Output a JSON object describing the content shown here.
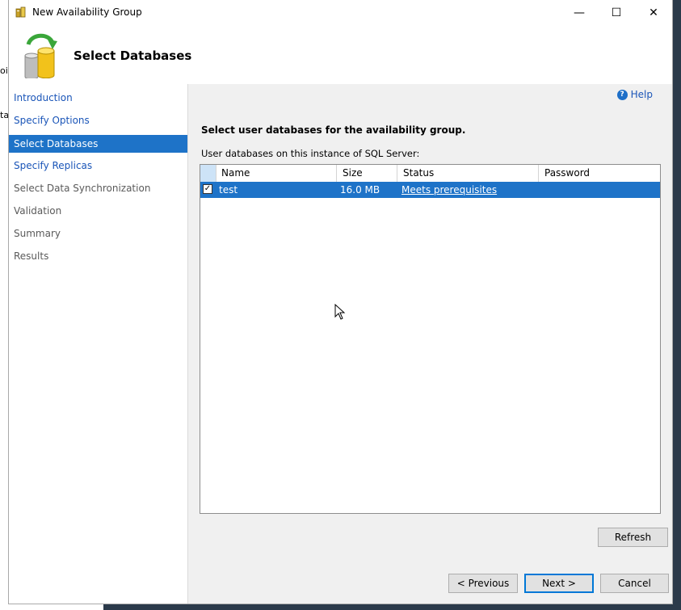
{
  "window": {
    "title": "New Availability Group",
    "controls": {
      "minimize": "—",
      "maximize": "☐",
      "close": "✕"
    }
  },
  "header": {
    "title": "Select Databases",
    "icon": "database-sync-icon"
  },
  "background_fragments": [
    "oil",
    "tal"
  ],
  "sidebar": {
    "items": [
      {
        "label": "Introduction",
        "state": "link"
      },
      {
        "label": "Specify Options",
        "state": "link"
      },
      {
        "label": "Select Databases",
        "state": "active"
      },
      {
        "label": "Specify Replicas",
        "state": "link"
      },
      {
        "label": "Select Data Synchronization",
        "state": "disabled"
      },
      {
        "label": "Validation",
        "state": "disabled"
      },
      {
        "label": "Summary",
        "state": "disabled"
      },
      {
        "label": "Results",
        "state": "disabled"
      }
    ]
  },
  "main": {
    "help_label": "Help",
    "instruction": "Select user databases for the availability group.",
    "sublabel": "User databases on this instance of SQL Server:",
    "table": {
      "columns": [
        "Name",
        "Size",
        "Status",
        "Password"
      ],
      "rows": [
        {
          "checked": true,
          "name": "test",
          "size": "16.0 MB",
          "status": "Meets prerequisites",
          "password": ""
        }
      ]
    },
    "refresh_label": "Refresh"
  },
  "footer": {
    "previous_label": "< Previous",
    "next_label": "Next >",
    "cancel_label": "Cancel"
  },
  "colors": {
    "selection": "#1e73c8",
    "link": "#1a55b8",
    "panel": "#f0f0f0"
  }
}
